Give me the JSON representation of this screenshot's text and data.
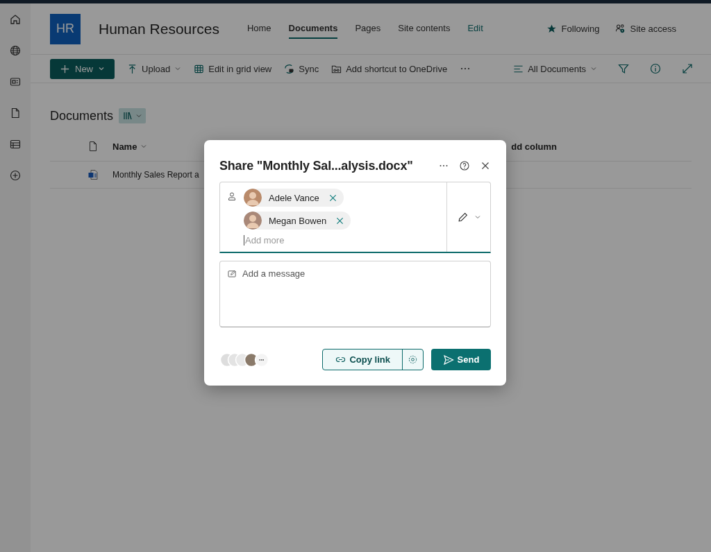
{
  "site": {
    "logo": "HR",
    "title": "Human Resources"
  },
  "nav": [
    {
      "label": "Home",
      "kind": "tab",
      "selected": false
    },
    {
      "label": "Documents",
      "kind": "tab",
      "selected": true
    },
    {
      "label": "Pages",
      "kind": "tab",
      "selected": false
    },
    {
      "label": "Site contents",
      "kind": "tab",
      "selected": false
    },
    {
      "label": "Edit",
      "kind": "edit",
      "selected": false
    }
  ],
  "site_actions": [
    {
      "label": "Following",
      "kind": "following"
    },
    {
      "label": "Site access",
      "kind": "access"
    }
  ],
  "command_bar": {
    "new_button": "New",
    "commands": [
      {
        "label": "Upload",
        "kind": "upload",
        "menu": true
      },
      {
        "label": "Edit in grid view",
        "kind": "grid",
        "menu": false
      },
      {
        "label": "Sync",
        "kind": "sync",
        "menu": false
      },
      {
        "label": "Add shortcut to OneDrive",
        "kind": "shortcut",
        "menu": false
      }
    ],
    "view": "All Documents"
  },
  "library": {
    "title": "Documents",
    "columns": [
      {
        "label": "Name"
      },
      {
        "label": "dd column"
      }
    ],
    "rows": [
      {
        "name": "Monthly Sales Report a"
      }
    ]
  },
  "dialog": {
    "title": "Share \"Monthly Sal...alysis.docx\"",
    "recipients": [
      {
        "name": "Adele Vance"
      },
      {
        "name": "Megan Bowen"
      }
    ],
    "add_placeholder": "Add more",
    "message_placeholder": "Add a message",
    "copy_link": "Copy link",
    "send": "Send"
  }
}
